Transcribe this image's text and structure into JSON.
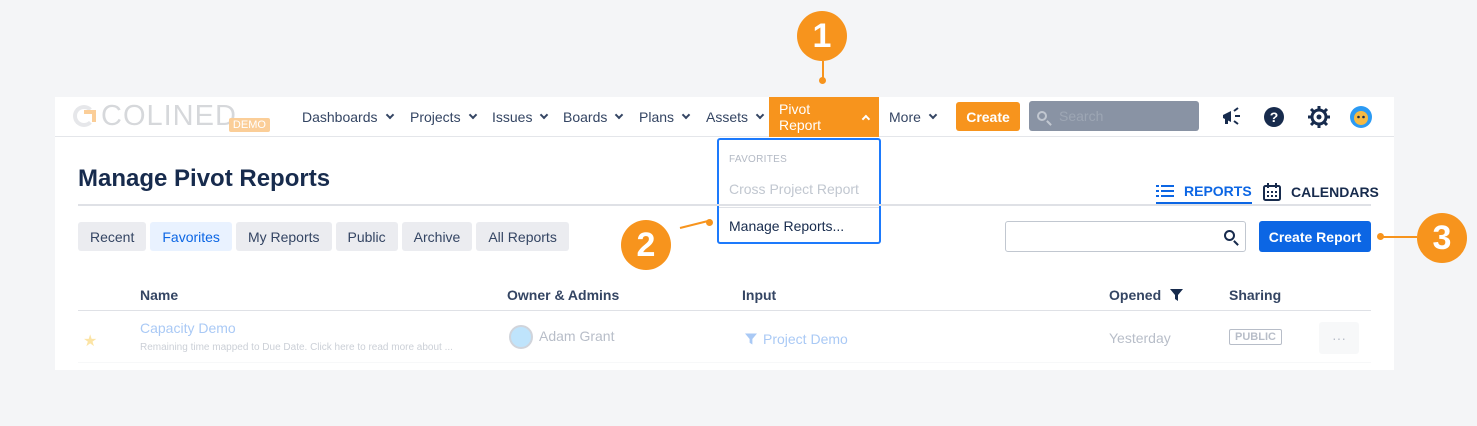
{
  "logo": {
    "text": "COLINED",
    "badge": "DEMO"
  },
  "nav": {
    "items": [
      {
        "label": "Dashboards"
      },
      {
        "label": "Projects"
      },
      {
        "label": "Issues"
      },
      {
        "label": "Boards"
      },
      {
        "label": "Plans"
      },
      {
        "label": "Assets"
      },
      {
        "label": "Pivot Report"
      },
      {
        "label": "More"
      }
    ],
    "create_label": "Create",
    "search_placeholder": "Search"
  },
  "dropdown": {
    "heading": "FAVORITES",
    "item_favorite": "Cross Project Report",
    "item_manage": "Manage Reports..."
  },
  "page": {
    "title": "Manage Pivot Reports",
    "view_tabs": {
      "reports": "REPORTS",
      "calendars": "CALENDARS"
    },
    "filter_tabs": [
      "Recent",
      "Favorites",
      "My Reports",
      "Public",
      "Archive",
      "All Reports"
    ],
    "create_report_label": "Create Report"
  },
  "table": {
    "headers": {
      "name": "Name",
      "owner": "Owner & Admins",
      "input": "Input",
      "opened": "Opened",
      "sharing": "Sharing"
    },
    "rows": [
      {
        "name": "Capacity Demo",
        "description": "Remaining time mapped to Due Date. Click here to read more about ...",
        "owner": "Adam Grant",
        "input": "Project Demo",
        "opened": "Yesterday",
        "sharing": "PUBLIC",
        "more": "···"
      }
    ]
  },
  "callouts": [
    "1",
    "2",
    "3"
  ],
  "colors": {
    "accent": "#f7941d",
    "primary": "#0c66e4"
  }
}
